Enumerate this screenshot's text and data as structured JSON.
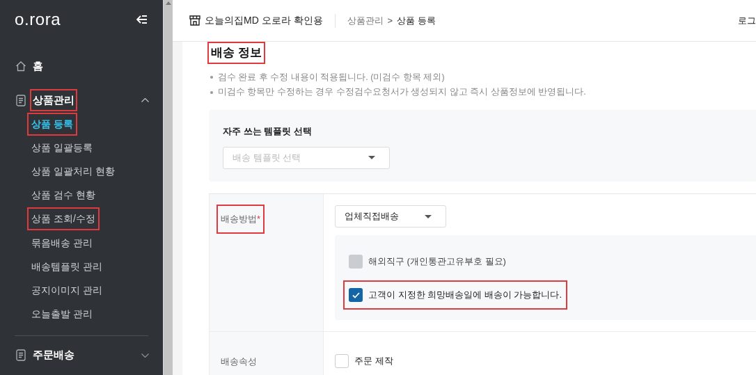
{
  "sidebar": {
    "logo": "o.rora",
    "items": [
      {
        "label": "홈",
        "kind": "home",
        "highlighted": false
      },
      {
        "label": "상품관리",
        "kind": "group",
        "expanded": true,
        "highlighted": true,
        "children": [
          {
            "label": "상품 등록",
            "selected": true,
            "highlighted": true
          },
          {
            "label": "상품 일괄등록",
            "selected": false,
            "highlighted": false
          },
          {
            "label": "상품 일괄처리 현황",
            "selected": false,
            "highlighted": false
          },
          {
            "label": "상품 검수 현황",
            "selected": false,
            "highlighted": false
          },
          {
            "label": "상품 조회/수정",
            "selected": false,
            "highlighted": true
          },
          {
            "label": "묶음배송 관리",
            "selected": false,
            "highlighted": false
          },
          {
            "label": "배송템플릿 관리",
            "selected": false,
            "highlighted": false
          },
          {
            "label": "공지이미지 관리",
            "selected": false,
            "highlighted": false
          },
          {
            "label": "오늘출발 관리",
            "selected": false,
            "highlighted": false
          }
        ]
      },
      {
        "label": "주문배송",
        "kind": "group",
        "expanded": false,
        "highlighted": false
      }
    ]
  },
  "header": {
    "store": "오늘의집MD 오로라 확인용",
    "breadcrumb": [
      "상품관리",
      "상품 등록"
    ],
    "separator": ">",
    "right_text": "로그"
  },
  "section": {
    "title": "배송 정보",
    "title_highlighted": true,
    "notes": [
      "검수 완료 후 수정 내용이 적용됩니다. (미검수 항목 제외)",
      "미검수 항목만 수정하는 경우 수정검수요청서가 생성되지 않고 즉시 상품정보에 반영됩니다."
    ],
    "template": {
      "label": "자주 쓰는 템플릿 선택",
      "placeholder": "배송 템플릿 선택"
    },
    "rows": [
      {
        "label": "배송방법",
        "required_mark": "*",
        "highlighted": true,
        "select": "업체직접배송",
        "options": [
          {
            "label": "해외직구 (개인통관고유부호 필요)",
            "checked": false,
            "disabled": true,
            "highlighted": false
          },
          {
            "label": "고객이 지정한 희망배송일에 배송이 가능합니다.",
            "checked": true,
            "disabled": false,
            "highlighted": true
          }
        ]
      },
      {
        "label": "배송속성",
        "highlighted": false,
        "options": [
          {
            "label": "주문 제작",
            "checked": false,
            "disabled": false,
            "highlighted": false
          }
        ]
      }
    ]
  }
}
